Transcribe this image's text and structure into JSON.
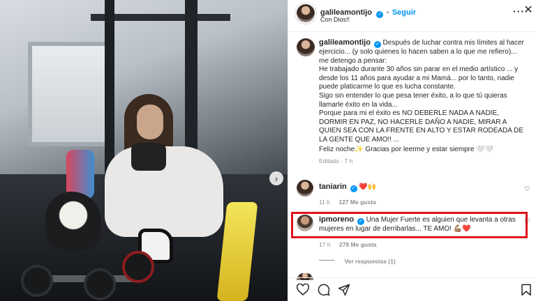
{
  "post": {
    "author": "galileamontijo",
    "follow_label": "Seguir",
    "location_line": "Con Dios!!",
    "more_icon": "more-horizontal-icon",
    "close_icon": "close-icon"
  },
  "caption": {
    "username": "galileamontijo",
    "lines": [
      "Después de luchar contra mis límites al hacer ejercicio... (y solo quienes lo hacen saben a lo que me refiero)... me detengo a pensar:",
      "He trabajado durante 30 años sin parar en el medio artístico ... y desde los 11 años para ayudar a mi Mamá... por lo tanto, nadie puede platicarme lo que es lucha constante.",
      "Sigo sin entender lo que pesa tener éxito, a lo que tú quieras llamarle éxito en la vida...",
      "Porque para mi el éxito es NO DEBERLE NADA A NADIE, DORMIR EN PAZ, NO HACERLE DAÑO A NADIE, MIRAR A QUIEN SEA CON LA FRENTE EN ALTO Y ESTAR RODEADA DE LA GENTE QUE AMO!! ...",
      "Feliz noche✨ Gracias por leerme y estar siempre 🤍🤍"
    ],
    "meta": "Editado · 7 h"
  },
  "comments": [
    {
      "username": "taniarin",
      "text": "❤️🙌",
      "age": "11 h",
      "likes": "127 Me gusta"
    },
    {
      "username": "ipmoreno",
      "text": "Una Mujer Fuerte es alguien que levanta a otras mujeres en lugar de derribarlas... TE AMO! 💪🏽❤️",
      "age": "17 h",
      "likes": "278 Me gusta",
      "replies": "Ver respuestas (1)"
    }
  ],
  "actions": {
    "like_icon": "heart-icon",
    "comment_icon": "comment-icon",
    "share_icon": "send-icon",
    "save_icon": "bookmark-icon"
  },
  "colors": {
    "accent": "#0095f6",
    "highlight_border": "#e0131b",
    "like_red": "#ed4956"
  }
}
